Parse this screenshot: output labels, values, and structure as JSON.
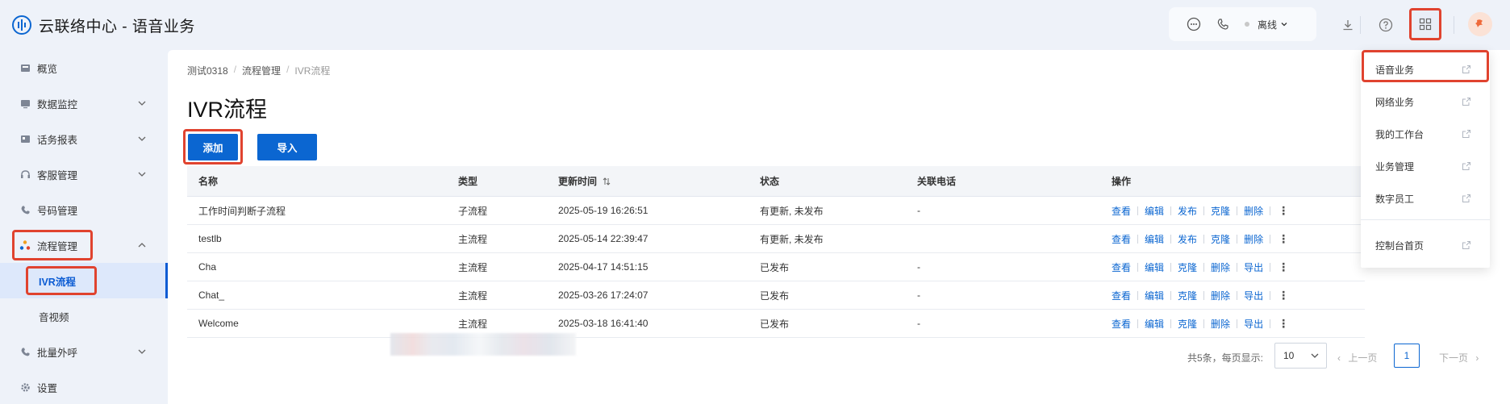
{
  "app": {
    "title": "云联络中心 - 语音业务",
    "status": "离线",
    "accent_color": "#0b66d1",
    "highlight_color": "#e0432f"
  },
  "sidebar": {
    "items": [
      {
        "label": "概览",
        "icon": "dashboard-icon"
      },
      {
        "label": "数据监控",
        "icon": "monitor-icon"
      },
      {
        "label": "话务报表",
        "icon": "report-icon"
      },
      {
        "label": "客服管理",
        "icon": "headset-icon"
      },
      {
        "label": "号码管理",
        "icon": "phone-icon"
      },
      {
        "label": "流程管理",
        "icon": "flow-icon"
      },
      {
        "label": "IVR流程",
        "icon": ""
      },
      {
        "label": "音视频",
        "icon": ""
      },
      {
        "label": "批量外呼",
        "icon": "outbound-call-icon"
      },
      {
        "label": "设置",
        "icon": "gear-icon"
      }
    ]
  },
  "breadcrumb": [
    "测试0318",
    "流程管理",
    "IVR流程"
  ],
  "page_title": "IVR流程",
  "buttons": {
    "add": "添加",
    "import": "导入"
  },
  "table": {
    "columns": [
      "名称",
      "类型",
      "更新时间",
      "状态",
      "关联电话",
      "操作"
    ],
    "rows": [
      {
        "name": "工作时间判断子流程",
        "type": "子流程",
        "time": "2025-05-19 16:26:51",
        "status": "有更新, 未发布",
        "phone": "-",
        "ops": [
          "查看",
          "编辑",
          "发布",
          "克隆",
          "删除"
        ]
      },
      {
        "name": "testlb",
        "type": "主流程",
        "time": "2025-05-14 22:39:47",
        "status": "有更新, 未发布",
        "phone": "",
        "ops": [
          "查看",
          "编辑",
          "发布",
          "克隆",
          "删除"
        ]
      },
      {
        "name": "Cha",
        "type": "主流程",
        "time": "2025-04-17 14:51:15",
        "status": "已发布",
        "phone": "-",
        "ops": [
          "查看",
          "编辑",
          "克隆",
          "删除",
          "导出"
        ]
      },
      {
        "name": "Chat_",
        "type": "主流程",
        "time": "2025-03-26 17:24:07",
        "status": "已发布",
        "phone": "-",
        "ops": [
          "查看",
          "编辑",
          "克隆",
          "删除",
          "导出"
        ]
      },
      {
        "name": "Welcome",
        "type": "主流程",
        "time": "2025-03-18 16:41:40",
        "status": "已发布",
        "phone": "-",
        "ops": [
          "查看",
          "编辑",
          "克隆",
          "删除",
          "导出"
        ]
      }
    ]
  },
  "pagination": {
    "total_text": "共5条，每页显示:",
    "page_size": "10",
    "prev": "上一页",
    "current": "1",
    "next": "下一页"
  },
  "dropdown": {
    "items": [
      "语音业务",
      "网络业务",
      "我的工作台",
      "业务管理",
      "数字员工"
    ],
    "footer": "控制台首页"
  }
}
